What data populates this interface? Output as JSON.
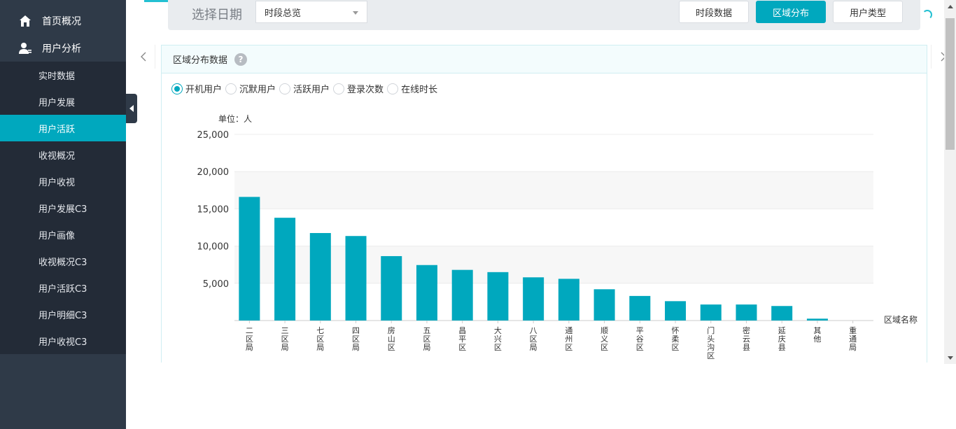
{
  "sidebar": {
    "top_items": [
      {
        "label": "首页概况",
        "icon": "home-icon"
      },
      {
        "label": "用户分析",
        "icon": "user-icon"
      }
    ],
    "sub_items": [
      {
        "label": "实时数据"
      },
      {
        "label": "用户发展"
      },
      {
        "label": "用户活跃",
        "active": true
      },
      {
        "label": "收视概况"
      },
      {
        "label": "用户收视"
      },
      {
        "label": "用户发展C3"
      },
      {
        "label": "用户画像"
      },
      {
        "label": "收视概况C3"
      },
      {
        "label": "用户活跃C3"
      },
      {
        "label": "用户明细C3"
      },
      {
        "label": "用户收视C3"
      }
    ]
  },
  "toolbar": {
    "date_label": "选择日期",
    "select_value": "时段总览",
    "buttons": [
      {
        "label": "时段数据",
        "active": false
      },
      {
        "label": "区域分布",
        "active": true
      },
      {
        "label": "用户类型",
        "active": false
      }
    ]
  },
  "panel": {
    "title": "区域分布数据",
    "help": "?",
    "radios": [
      {
        "label": "开机用户",
        "checked": true
      },
      {
        "label": "沉默用户",
        "checked": false
      },
      {
        "label": "活跃用户",
        "checked": false
      },
      {
        "label": "登录次数",
        "checked": false
      },
      {
        "label": "在线时长",
        "checked": false
      }
    ]
  },
  "colors": {
    "accent": "#00a8be",
    "sidebar": "#2f3a48",
    "sidebar_sub": "#232b37"
  },
  "chart_data": {
    "type": "bar",
    "unit_label": "单位：人",
    "xlabel": "区域名称",
    "ylim": [
      0,
      25000
    ],
    "yticks": [
      5000,
      10000,
      15000,
      20000,
      25000
    ],
    "ytick_labels": [
      "5,000",
      "10,000",
      "15,000",
      "20,000",
      "25,000"
    ],
    "categories": [
      "二区局",
      "三区局",
      "七区局",
      "四区局",
      "房山区",
      "五区局",
      "昌平区",
      "大兴区",
      "八区局",
      "通州区",
      "顺义区",
      "平谷区",
      "怀柔区",
      "门头沟区",
      "密云县",
      "延庆县",
      "其他",
      "重通局"
    ],
    "values": [
      16600,
      13800,
      11750,
      11350,
      8650,
      7450,
      6800,
      6500,
      5800,
      5600,
      4200,
      3300,
      2600,
      2150,
      2150,
      1950,
      250,
      0
    ],
    "bar_color": "#00a8be",
    "grid": true
  }
}
